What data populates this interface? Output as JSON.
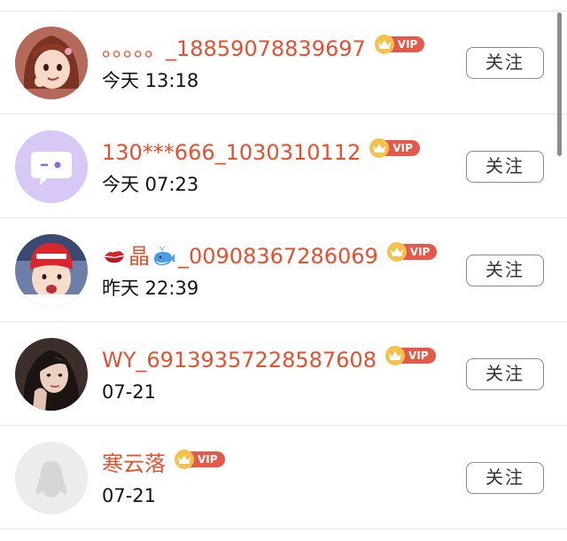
{
  "users": [
    {
      "name": "。。。。。_18859078839697",
      "time": "今天 13:18",
      "vip_label": "VIP",
      "follow_label": "关注",
      "avatar": "anime-girl-avatar"
    },
    {
      "name": "130***666_1030310112",
      "time": "今天 07:23",
      "vip_label": "VIP",
      "follow_label": "关注",
      "avatar": "chat-bubble-avatar"
    },
    {
      "name_prefix": "晶",
      "name_suffix": "_00908367286069",
      "prefix_emoji": "kiss-mark-emoji",
      "suffix_emoji": "whale-emoji",
      "time": "昨天 22:39",
      "vip_label": "VIP",
      "follow_label": "关注",
      "avatar": "child-red-hat-avatar"
    },
    {
      "name": "WY_69139357228587608",
      "time": "07-21",
      "vip_label": "VIP",
      "follow_label": "关注",
      "avatar": "woman-portrait-avatar"
    },
    {
      "name": "寒云落",
      "time": "07-21",
      "vip_label": "VIP",
      "follow_label": "关注",
      "avatar": "default-penguin-avatar"
    }
  ],
  "colors": {
    "name": "#e5502f",
    "vip_label_bg": "#e5584a",
    "vip_crown": "#f3c24a",
    "avatar_lavender": "#d8c8f5",
    "divider": "#e6e6e6"
  }
}
